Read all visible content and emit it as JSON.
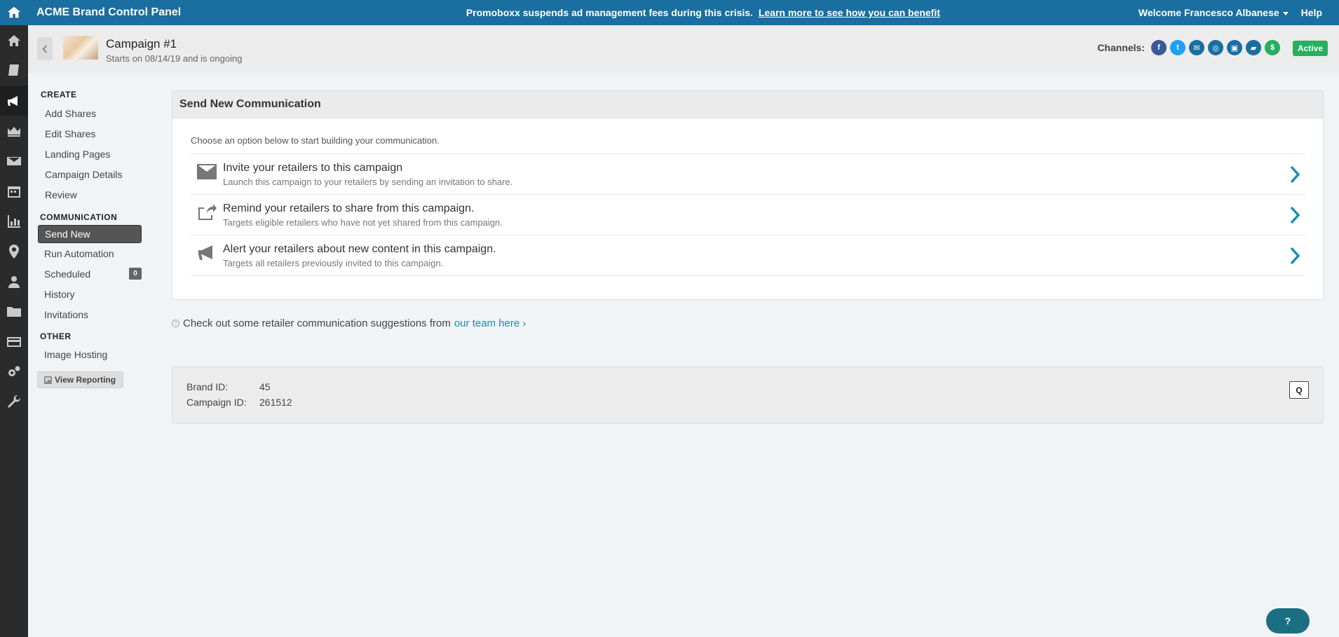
{
  "app": {
    "title": "ACME Brand Control Panel"
  },
  "announcement": {
    "text": "Promoboxx suspends ad management fees during this crisis.",
    "link": "Learn more to see how you can benefit"
  },
  "user": {
    "welcome": "Welcome Francesco Albanese",
    "help": "Help"
  },
  "rail": [
    "home-icon",
    "book-icon",
    "megaphone-icon",
    "crown-icon",
    "envelope-icon",
    "calendar-icon",
    "bar-chart-icon",
    "map-pin-icon",
    "user-icon",
    "folder-icon",
    "credit-card-icon",
    "gears-icon",
    "wrench-icon"
  ],
  "campaign": {
    "title": "Campaign #1",
    "subtitle": "Starts on 08/14/19 and is ongoing",
    "channels_label": "Channels:",
    "channels": [
      {
        "icon": "facebook-icon",
        "glyph": "f",
        "color": "#3b5998"
      },
      {
        "icon": "twitter-icon",
        "glyph": "t",
        "color": "#1da1f2"
      },
      {
        "icon": "email-icon",
        "glyph": "✉",
        "color": "#1a6ea0"
      },
      {
        "icon": "instagram-icon",
        "glyph": "◎",
        "color": "#1a6ea0"
      },
      {
        "icon": "image-icon",
        "glyph": "▣",
        "color": "#1a6ea0"
      },
      {
        "icon": "folder-icon",
        "glyph": "▰",
        "color": "#1a6ea0"
      },
      {
        "icon": "dollar-icon",
        "glyph": "$",
        "color": "#27ae60"
      }
    ],
    "status": "Active"
  },
  "nav": {
    "create_label": "CREATE",
    "create": [
      "Add Shares",
      "Edit Shares",
      "Landing Pages",
      "Campaign Details",
      "Review"
    ],
    "communication_label": "COMMUNICATION",
    "communication": [
      "Send New",
      "Run Automation",
      "Scheduled",
      "History",
      "Invitations"
    ],
    "scheduled_count": "0",
    "other_label": "OTHER",
    "other": [
      "Image Hosting"
    ],
    "view_reporting": "View Reporting"
  },
  "card": {
    "title": "Send New Communication",
    "intro": "Choose an option below to start building your communication.",
    "options": [
      {
        "title": "Invite your retailers to this campaign",
        "desc": "Launch this campaign to your retailers by sending an invitation to share."
      },
      {
        "title": "Remind your retailers to share from this campaign.",
        "desc": "Targets eligible retailers who have not yet shared from this campaign."
      },
      {
        "title": "Alert your retailers about new content in this campaign.",
        "desc": "Targets all retailers previously invited to this campaign."
      }
    ]
  },
  "suggestion": {
    "text": "Check out some retailer communication suggestions from",
    "link": "our team here ›"
  },
  "ids": {
    "brand_label": "Brand ID:",
    "brand_value": "45",
    "campaign_label": "Campaign ID:",
    "campaign_value": "261512",
    "button": "Q"
  },
  "help_fab": "?"
}
